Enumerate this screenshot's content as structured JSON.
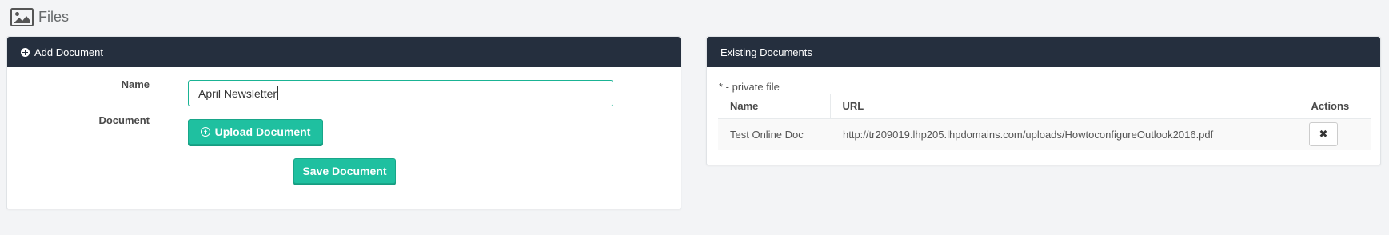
{
  "page": {
    "title": "Files",
    "icon": "image-icon"
  },
  "add_document": {
    "heading": "Add Document",
    "heading_icon": "plus-circle-icon",
    "name_label": "Name",
    "name_value": "April Newsletter",
    "document_label": "Document",
    "upload_button": "Upload Document",
    "upload_icon": "arrow-up-circle-icon",
    "save_button": "Save Document"
  },
  "existing_documents": {
    "heading": "Existing Documents",
    "note": "* - private file",
    "columns": [
      "Name",
      "URL",
      "Actions"
    ],
    "rows": [
      {
        "name": "Test Online Doc",
        "url": "http://tr209019.lhp205.lhpdomains.com/uploads/HowtoconfigureOutlook2016.pdf",
        "action_icon": "close-icon",
        "action_label": "✖"
      }
    ]
  },
  "colors": {
    "header_bg": "#252f3e",
    "accent": "#1fc0a0",
    "page_bg": "#f3f4f6"
  }
}
